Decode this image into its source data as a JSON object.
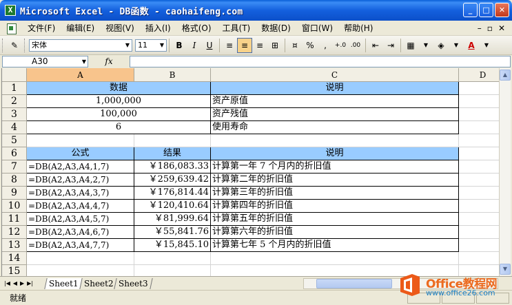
{
  "window": {
    "title": "Microsoft Excel - DB函数 - caohaifeng.com"
  },
  "menubar": {
    "items": [
      "文件(F)",
      "编辑(E)",
      "视图(V)",
      "插入(I)",
      "格式(O)",
      "工具(T)",
      "数据(D)",
      "窗口(W)",
      "帮助(H)"
    ]
  },
  "toolbar": {
    "font_name": "宋体",
    "font_size": "11",
    "percent": "%",
    "comma": ","
  },
  "formula_bar": {
    "name_box": "A30",
    "fx_label": "fx",
    "formula": ""
  },
  "columns": [
    "A",
    "B",
    "C",
    "D"
  ],
  "rows": [
    "1",
    "2",
    "3",
    "4",
    "5",
    "6",
    "7",
    "8",
    "9",
    "10",
    "11",
    "12",
    "13",
    "14",
    "15"
  ],
  "table1": {
    "header_data": "数据",
    "header_desc": "说明",
    "rows": [
      {
        "value": "1,000,000",
        "desc": "资产原值"
      },
      {
        "value": "100,000",
        "desc": "资产残值"
      },
      {
        "value": "6",
        "desc": "使用寿命"
      }
    ]
  },
  "table2": {
    "header_formula": "公式",
    "header_result": "结果",
    "header_desc": "说明",
    "rows": [
      {
        "formula": "=DB(A2,A3,A4,1,7)",
        "result": "￥186,083.33",
        "desc": "计算第一年 7 个月内的折旧值"
      },
      {
        "formula": "=DB(A2,A3,A4,2,7)",
        "result": "￥259,639.42",
        "desc": "计算第二年的折旧值"
      },
      {
        "formula": "=DB(A2,A3,A4,3,7)",
        "result": "￥176,814.44",
        "desc": "计算第三年的折旧值"
      },
      {
        "formula": "=DB(A2,A3,A4,4,7)",
        "result": "￥120,410.64",
        "desc": "计算第四年的折旧值"
      },
      {
        "formula": "=DB(A2,A3,A4,5,7)",
        "result": "￥81,999.64",
        "desc": "计算第五年的折旧值"
      },
      {
        "formula": "=DB(A2,A3,A4,6,7)",
        "result": "￥55,841.76",
        "desc": "计算第六年的折旧值"
      },
      {
        "formula": "=DB(A2,A3,A4,7,7)",
        "result": "￥15,845.10",
        "desc": "计算第七年 5 个月内的折旧值"
      }
    ]
  },
  "sheet_tabs": [
    "Sheet1",
    "Sheet2",
    "Sheet3"
  ],
  "status": {
    "text": "就绪"
  },
  "watermark": {
    "name": "Office教程网",
    "url": "www.office26.com"
  },
  "colors": {
    "header_fill": "#99ccff",
    "selected_col": "#f8c48c",
    "title_blue": "#0b4fc9"
  }
}
